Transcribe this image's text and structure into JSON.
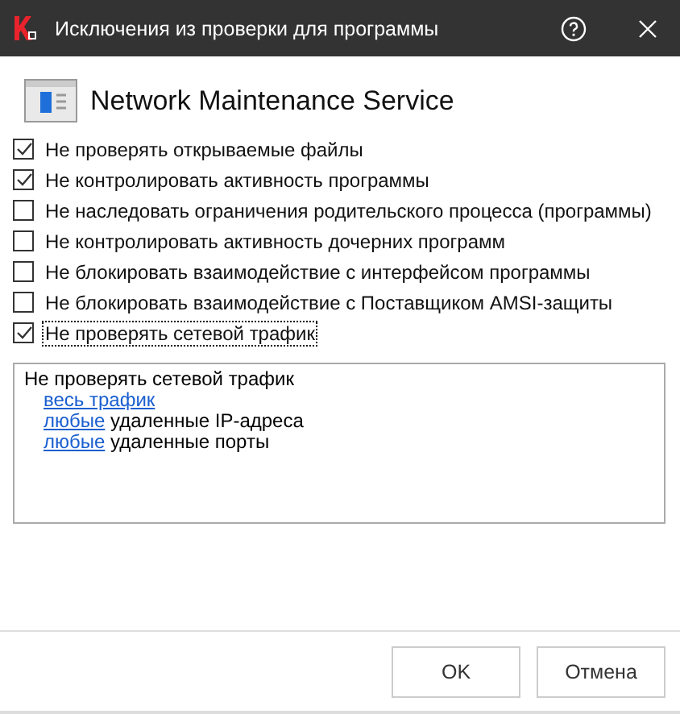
{
  "window": {
    "title": "Исключения из проверки для программы"
  },
  "heading": "Network Maintenance Service",
  "options": [
    {
      "label": "Не проверять открываемые файлы",
      "checked": true,
      "focused": false
    },
    {
      "label": "Не контролировать активность программы",
      "checked": true,
      "focused": false
    },
    {
      "label": "Не наследовать ограничения родительского процесса (программы)",
      "checked": false,
      "focused": false
    },
    {
      "label": "Не контролировать активность дочерних программ",
      "checked": false,
      "focused": false
    },
    {
      "label": "Не блокировать взаимодействие с интерфейсом программы",
      "checked": false,
      "focused": false
    },
    {
      "label": "Не блокировать взаимодействие с Поставщиком AMSI-защиты",
      "checked": false,
      "focused": false
    },
    {
      "label": "Не проверять сетевой трафик",
      "checked": true,
      "focused": true
    }
  ],
  "details": {
    "title": "Не проверять сетевой трафик",
    "lines": [
      {
        "link": "весь трафик"
      },
      {
        "link": "любые",
        "text": "удаленные IP-адреса"
      },
      {
        "link": "любые",
        "text": "удаленные порты"
      }
    ]
  },
  "buttons": [
    "OK",
    "Отмена"
  ]
}
